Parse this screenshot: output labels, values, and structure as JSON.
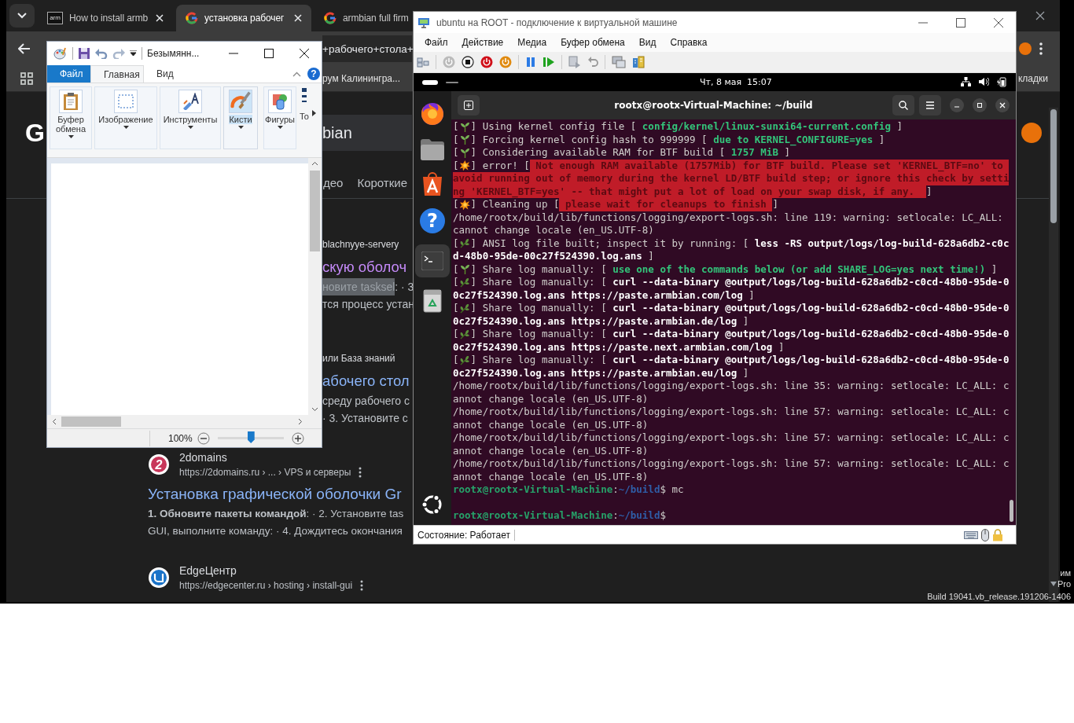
{
  "browser": {
    "tabs": [
      {
        "kind": "site",
        "favicon_text": "arm",
        "label": "How to install armb",
        "clipped": false,
        "selected": false
      },
      {
        "kind": "google",
        "label": "установка рабочег",
        "clipped": false,
        "selected": true
      },
      {
        "kind": "google",
        "label": "armbian full firm",
        "clipped": true,
        "selected": false
      }
    ],
    "address_fragment": "+рабочего+стола+",
    "bookmark_fragment": "рум Калинингра...",
    "bookmark_right": "кладки",
    "logo_fragment": "G",
    "search_fragment": "bian",
    "search_tabs": [
      "део",
      "Короткие"
    ],
    "partial_results": [
      {
        "source": "blachnyye-servery",
        "title": "скую оболоч",
        "visited": true,
        "snippet_lines": [
          [
            {
              "text": "новите tasksel",
              "highlight": true
            },
            {
              "text": ": · 3",
              "highlight": false
            }
          ],
          [
            {
              "text": "тся процесс устан",
              "highlight": false
            }
          ]
        ]
      },
      {
        "source": "или База знаний",
        "title": "абочего стол",
        "visited": false,
        "snippet_lines": [
          [
            {
              "text": "среду рабочего с",
              "highlight": false
            }
          ],
          [
            {
              "text": "· 3. Установите с",
              "highlight": false
            }
          ]
        ]
      }
    ],
    "results": [
      {
        "kind": "badge",
        "logo_text": "2",
        "site": "2domains",
        "url": "https://2domains.ru › ... › VPS и серверы",
        "title": "Установка графической оболочки Gr",
        "snippet_lines": [
          "**1. Обновите пакеты командой**: · 2. Установите tas",
          "GUI, выполните команду: · 4. Дождитесь окончания"
        ]
      },
      {
        "kind": "edge",
        "site": "EdgeЦентр",
        "url": "https://edgecenter.ru › hosting › install-gui"
      }
    ]
  },
  "desktop_text": [
    "им",
    "Pro",
    "Build 19041.vb_release.191206-1406"
  ],
  "paint": {
    "title": "Безымянн...",
    "help_glyph": "?",
    "ribbon_tabs": [
      {
        "kind": "file",
        "label": "Файл",
        "selected": false
      },
      {
        "kind": "tab",
        "label": "Главная",
        "selected": true
      },
      {
        "kind": "tab",
        "label": "Вид",
        "selected": false
      }
    ],
    "groups": [
      {
        "label": "Буфер обмена",
        "selected": false
      },
      {
        "label": "Изображение",
        "selected": false
      },
      {
        "label": "Инструменты",
        "selected": false
      },
      {
        "label": "Кисти",
        "selected": true
      },
      {
        "label": "Фигуры",
        "selected": false
      },
      {
        "label": "То",
        "selected": false
      }
    ],
    "zoom": {
      "reading": "100%",
      "level": 0.5
    }
  },
  "vm": {
    "title": "ubuntu на ROOT - подключение к виртуальной машине",
    "menu": [
      "Файл",
      "Действие",
      "Медиа",
      "Буфер обмена",
      "Вид",
      "Справка"
    ],
    "clock": "Чт, 8 мая  15:07",
    "help_glyph": "?",
    "terminal": {
      "title": "rootx@rootx-Virtual-Machine: ~/build",
      "rows": [
        {
          "parts": [
            {
              "kind": "text",
              "text": "["
            },
            {
              "kind": "sprout"
            },
            {
              "kind": "text",
              "text": "] Using kernel config file [ "
            },
            {
              "kind": "green",
              "text": "config/kernel/linux-sunxi64-current.config"
            },
            {
              "kind": "text",
              "text": " ]"
            }
          ]
        },
        {
          "parts": [
            {
              "kind": "text",
              "text": "["
            },
            {
              "kind": "sprout"
            },
            {
              "kind": "text",
              "text": "] Forcing kernel config hash to 999999 [ "
            },
            {
              "kind": "green",
              "text": "due to KERNEL_CONFIGURE=yes"
            },
            {
              "kind": "text",
              "text": " ]"
            }
          ]
        },
        {
          "parts": [
            {
              "kind": "text",
              "text": "["
            },
            {
              "kind": "sprout"
            },
            {
              "kind": "text",
              "text": "] Considering available RAM for BTF build [ "
            },
            {
              "kind": "green",
              "text": "1757 MiB"
            },
            {
              "kind": "text",
              "text": " ]"
            }
          ]
        },
        {
          "parts": [
            {
              "kind": "text",
              "text": "["
            },
            {
              "kind": "burst"
            },
            {
              "kind": "text",
              "text": "] error! ["
            },
            {
              "kind": "alert",
              "text": " Not enough RAM available (1757Mib) for BTF build. Please set 'KERNEL_BTF=no' to "
            }
          ]
        },
        {
          "parts": [
            {
              "kind": "alert",
              "text": "avoid running out of memory during the kernel LD/BTF build step; or ignore this check by setti"
            }
          ]
        },
        {
          "parts": [
            {
              "kind": "alert",
              "text": "ng 'KERNEL_BTF=yes' -- that might put a lot of load on your swap disk, if any.  "
            },
            {
              "kind": "text",
              "text": "]"
            }
          ]
        },
        {
          "parts": [
            {
              "kind": "text",
              "text": "["
            },
            {
              "kind": "burst"
            },
            {
              "kind": "text",
              "text": "] Cleaning up ["
            },
            {
              "kind": "alert",
              "text": " please wait for cleanups to finish "
            },
            {
              "kind": "text",
              "text": "]"
            }
          ]
        },
        {
          "parts": [
            {
              "kind": "text",
              "text": "/home/rootx/build/lib/functions/logging/export-logs.sh: line 119: warning: setlocale: LC_ALL:"
            }
          ]
        },
        {
          "parts": [
            {
              "kind": "text",
              "text": "cannot change locale (en_US.UTF-8)"
            }
          ]
        },
        {
          "parts": [
            {
              "kind": "text",
              "text": "["
            },
            {
              "kind": "herb"
            },
            {
              "kind": "text",
              "text": "] ANSI log file built; inspect it by running: [ "
            },
            {
              "kind": "bold",
              "text": "less -RS output/logs/log-build-628a6db2-c0c"
            }
          ]
        },
        {
          "parts": [
            {
              "kind": "bold",
              "text": "d-48b0-95de-00c27f524390.log.ans"
            },
            {
              "kind": "text",
              "text": " ]"
            }
          ]
        },
        {
          "parts": [
            {
              "kind": "text",
              "text": "["
            },
            {
              "kind": "sprout"
            },
            {
              "kind": "text",
              "text": "] Share log manually: [ "
            },
            {
              "kind": "green",
              "text": "use one of the commands below (or add SHARE_LOG=yes next time!)"
            },
            {
              "kind": "text",
              "text": " ]"
            }
          ]
        },
        {
          "parts": [
            {
              "kind": "text",
              "text": "["
            },
            {
              "kind": "herb"
            },
            {
              "kind": "text",
              "text": "] Share log manually: [ "
            },
            {
              "kind": "bold",
              "text": "curl --data-binary @output/logs/log-build-628a6db2-c0cd-48b0-95de-0"
            }
          ]
        },
        {
          "parts": [
            {
              "kind": "bold",
              "text": "0c27f524390.log.ans https://paste.armbian.com/log"
            },
            {
              "kind": "text",
              "text": " ]"
            }
          ]
        },
        {
          "parts": [
            {
              "kind": "text",
              "text": "["
            },
            {
              "kind": "herb"
            },
            {
              "kind": "text",
              "text": "] Share log manually: [ "
            },
            {
              "kind": "bold",
              "text": "curl --data-binary @output/logs/log-build-628a6db2-c0cd-48b0-95de-0"
            }
          ]
        },
        {
          "parts": [
            {
              "kind": "bold",
              "text": "0c27f524390.log.ans https://paste.armbian.de/log"
            },
            {
              "kind": "text",
              "text": " ]"
            }
          ]
        },
        {
          "parts": [
            {
              "kind": "text",
              "text": "["
            },
            {
              "kind": "herb"
            },
            {
              "kind": "text",
              "text": "] Share log manually: [ "
            },
            {
              "kind": "bold",
              "text": "curl --data-binary @output/logs/log-build-628a6db2-c0cd-48b0-95de-0"
            }
          ]
        },
        {
          "parts": [
            {
              "kind": "bold",
              "text": "0c27f524390.log.ans https://paste.next.armbian.com/log"
            },
            {
              "kind": "text",
              "text": " ]"
            }
          ]
        },
        {
          "parts": [
            {
              "kind": "text",
              "text": "["
            },
            {
              "kind": "herb"
            },
            {
              "kind": "text",
              "text": "] Share log manually: [ "
            },
            {
              "kind": "bold",
              "text": "curl --data-binary @output/logs/log-build-628a6db2-c0cd-48b0-95de-0"
            }
          ]
        },
        {
          "parts": [
            {
              "kind": "bold",
              "text": "0c27f524390.log.ans https://paste.armbian.eu/log"
            },
            {
              "kind": "text",
              "text": " ]"
            }
          ]
        },
        {
          "parts": [
            {
              "kind": "text",
              "text": "/home/rootx/build/lib/functions/logging/export-logs.sh: line 35: warning: setlocale: LC_ALL: c"
            }
          ]
        },
        {
          "parts": [
            {
              "kind": "text",
              "text": "annot change locale (en_US.UTF-8)"
            }
          ]
        },
        {
          "parts": [
            {
              "kind": "text",
              "text": "/home/rootx/build/lib/functions/logging/export-logs.sh: line 57: warning: setlocale: LC_ALL: c"
            }
          ]
        },
        {
          "parts": [
            {
              "kind": "text",
              "text": "annot change locale (en_US.UTF-8)"
            }
          ]
        },
        {
          "parts": [
            {
              "kind": "text",
              "text": "/home/rootx/build/lib/functions/logging/export-logs.sh: line 57: warning: setlocale: LC_ALL: c"
            }
          ]
        },
        {
          "parts": [
            {
              "kind": "text",
              "text": "annot change locale (en_US.UTF-8)"
            }
          ]
        },
        {
          "parts": [
            {
              "kind": "text",
              "text": "/home/rootx/build/lib/functions/logging/export-logs.sh: line 57: warning: setlocale: LC_ALL: c"
            }
          ]
        },
        {
          "parts": [
            {
              "kind": "text",
              "text": "annot change locale (en_US.UTF-8)"
            }
          ]
        },
        {
          "parts": [
            {
              "kind": "user",
              "text": "rootx@rootx-Virtual-Machine"
            },
            {
              "kind": "text",
              "text": ":"
            },
            {
              "kind": "path",
              "text": "~/build"
            },
            {
              "kind": "text",
              "text": "$ mc"
            }
          ]
        },
        {
          "gap_before": true,
          "parts": [
            {
              "kind": "user",
              "text": "rootx@rootx-Virtual-Machine"
            },
            {
              "kind": "text",
              "text": ":"
            },
            {
              "kind": "path",
              "text": "~/build"
            },
            {
              "kind": "text",
              "text": "$"
            }
          ]
        }
      ]
    },
    "status": "Состояние: Работает"
  }
}
